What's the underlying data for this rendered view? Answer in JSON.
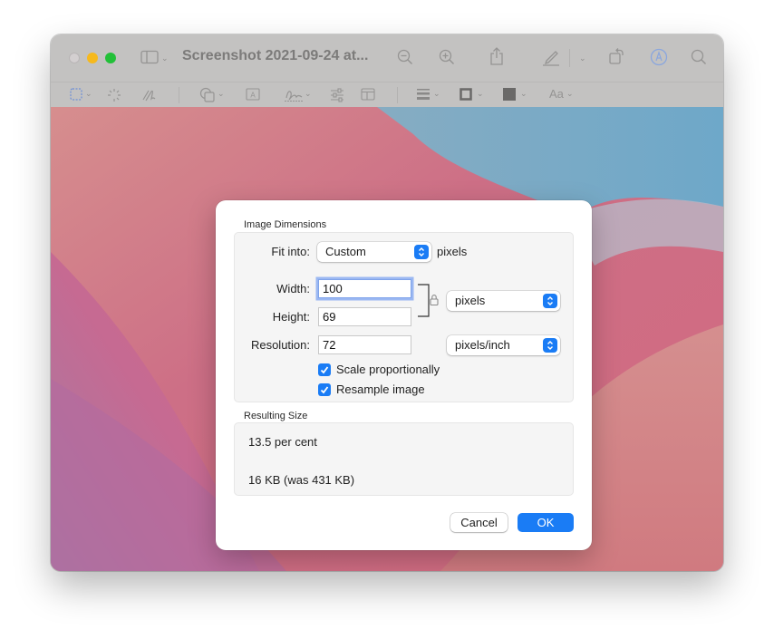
{
  "window": {
    "title": "Screenshot 2021-09-24 at...",
    "traffic_lights": [
      "close",
      "minimize",
      "maximize"
    ],
    "toolbar_icons": [
      "sidebar-icon",
      "zoom-out-icon",
      "zoom-in-icon",
      "share-icon",
      "pencil-icon",
      "rotate-icon",
      "markup-icon",
      "search-icon"
    ],
    "markup_toolbar_icons": [
      "rectangular-selection-icon",
      "instant-alpha-icon",
      "sketch-icon",
      "shapes-icon",
      "text-box-icon",
      "signature-icon",
      "adjust-color-icon",
      "page-layout-icon",
      "line-style-icon",
      "border-color-icon",
      "fill-color-icon",
      "font-icon"
    ],
    "font_button_label": "Aa"
  },
  "dialog": {
    "image_dimensions": {
      "section_label": "Image Dimensions",
      "fit_into_label": "Fit into:",
      "fit_into_value": "Custom",
      "fit_into_unit": "pixels",
      "width_label": "Width:",
      "width_value": "100",
      "height_label": "Height:",
      "height_value": "69",
      "size_unit_value": "pixels",
      "resolution_label": "Resolution:",
      "resolution_value": "72",
      "resolution_unit_value": "pixels/inch",
      "scale_proportionally_label": "Scale proportionally",
      "scale_proportionally_checked": true,
      "resample_label": "Resample image",
      "resample_checked": true
    },
    "resulting_size": {
      "section_label": "Resulting Size",
      "percent_text": "13.5 per cent",
      "size_text": "16 KB (was 431 KB)"
    },
    "buttons": {
      "cancel": "Cancel",
      "ok": "OK"
    }
  },
  "colors": {
    "accent": "#1a7cf5",
    "titlebar": "#c3c2c1",
    "canvas_pink": "#cf6f8a",
    "canvas_blue": "#7fb0c8"
  }
}
